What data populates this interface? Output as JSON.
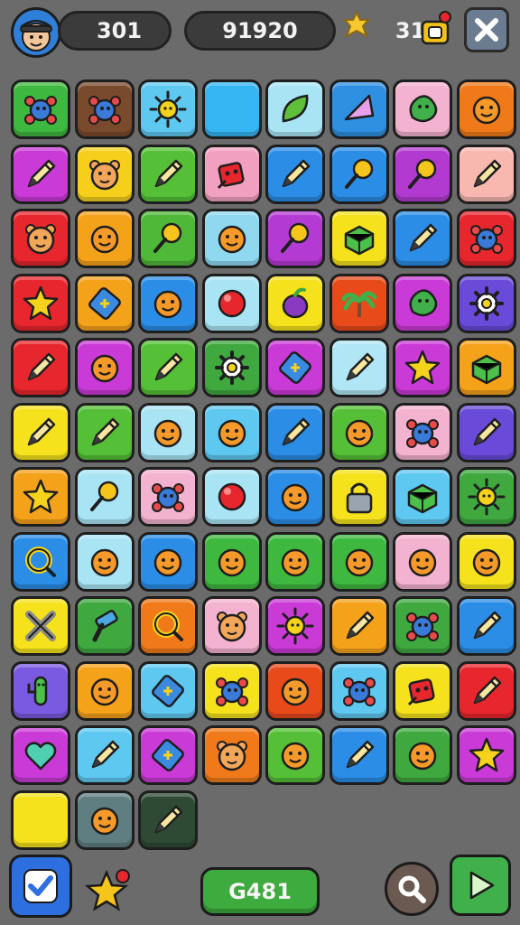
{
  "header": {
    "level": "301",
    "score": "91920",
    "coins": "310"
  },
  "footer": {
    "moves": "G481"
  },
  "icon_names": {
    "avatar": "player-avatar",
    "coin": "coin-icon",
    "gift": "gift-icon",
    "close": "close-icon",
    "check": "check-icon",
    "star": "star-icon",
    "search": "magnifier-icon",
    "play": "play-icon"
  },
  "colors": {
    "board_background": "#6b6b6b",
    "tile_outline": "#1e1e1e"
  },
  "board": {
    "rows": [
      [
        {
          "c": "#3fb83f",
          "i": "bug"
        },
        {
          "c": "#7a4a2c",
          "i": "bug"
        },
        {
          "c": "#5ec8f0",
          "i": "sun"
        },
        {
          "c": "#35b5f2",
          "i": "blank"
        },
        {
          "c": "#a9e4f5",
          "i": "leaf"
        },
        {
          "c": "#2f8fe0",
          "i": "gem"
        },
        {
          "c": "#f3b2cf",
          "i": "blob"
        },
        {
          "c": "#f07a1a",
          "i": "face"
        }
      ],
      [
        {
          "c": "#c93ad6",
          "i": "pencil"
        },
        {
          "c": "#f5cf1c",
          "i": "bear"
        },
        {
          "c": "#55c037",
          "i": "pencil"
        },
        {
          "c": "#f2a0c0",
          "i": "robot"
        },
        {
          "c": "#2b8de6",
          "i": "pencil"
        },
        {
          "c": "#2b8de6",
          "i": "lolly"
        },
        {
          "c": "#b23ad0",
          "i": "lolly"
        },
        {
          "c": "#f8b8b0",
          "i": "pencil"
        }
      ],
      [
        {
          "c": "#e8262e",
          "i": "bear"
        },
        {
          "c": "#f4a21a",
          "i": "face"
        },
        {
          "c": "#50b838",
          "i": "lolly"
        },
        {
          "c": "#8fd8f0",
          "i": "face"
        },
        {
          "c": "#b43ad4",
          "i": "lolly"
        },
        {
          "c": "#f5e21c",
          "i": "box"
        },
        {
          "c": "#2b8de6",
          "i": "pencil"
        },
        {
          "c": "#e8262e",
          "i": "bug"
        }
      ],
      [
        {
          "c": "#e8262e",
          "i": "star"
        },
        {
          "c": "#f4a21a",
          "i": "card"
        },
        {
          "c": "#2b8de6",
          "i": "face"
        },
        {
          "c": "#a9e4f5",
          "i": "ball"
        },
        {
          "c": "#f5e21c",
          "i": "fruit"
        },
        {
          "c": "#e84a1a",
          "i": "palm"
        },
        {
          "c": "#c93ad6",
          "i": "blob"
        },
        {
          "c": "#6a4ad8",
          "i": "gear"
        }
      ],
      [
        {
          "c": "#e8262e",
          "i": "pencil"
        },
        {
          "c": "#c93ad6",
          "i": "face"
        },
        {
          "c": "#55c037",
          "i": "pencil"
        },
        {
          "c": "#3fa83f",
          "i": "gear"
        },
        {
          "c": "#c93ad6",
          "i": "card"
        },
        {
          "c": "#b0e6f5",
          "i": "pencil"
        },
        {
          "c": "#c93ad6",
          "i": "star"
        },
        {
          "c": "#f4a21a",
          "i": "box"
        }
      ],
      [
        {
          "c": "#f5e21c",
          "i": "pencil"
        },
        {
          "c": "#55c037",
          "i": "pencil"
        },
        {
          "c": "#a9e4f5",
          "i": "face"
        },
        {
          "c": "#5ec8f0",
          "i": "face"
        },
        {
          "c": "#2b8de6",
          "i": "pencil"
        },
        {
          "c": "#55c037",
          "i": "face"
        },
        {
          "c": "#f3b2cf",
          "i": "bug"
        },
        {
          "c": "#6a4ad8",
          "i": "pencil"
        }
      ],
      [
        {
          "c": "#f4a21a",
          "i": "star"
        },
        {
          "c": "#a9e4f5",
          "i": "lolly"
        },
        {
          "c": "#f3b2cf",
          "i": "bug"
        },
        {
          "c": "#a9e4f5",
          "i": "ball"
        },
        {
          "c": "#2b8de6",
          "i": "face"
        },
        {
          "c": "#f5e21c",
          "i": "lock"
        },
        {
          "c": "#5ec8f0",
          "i": "box"
        },
        {
          "c": "#3fa83f",
          "i": "sun"
        }
      ],
      [
        {
          "c": "#2b8de6",
          "i": "ring"
        },
        {
          "c": "#a9e4f5",
          "i": "face"
        },
        {
          "c": "#2b8de6",
          "i": "face"
        },
        {
          "c": "#3fb83f",
          "i": "face"
        },
        {
          "c": "#3fb83f",
          "i": "face"
        },
        {
          "c": "#3fb83f",
          "i": "face"
        },
        {
          "c": "#f3b2cf",
          "i": "face"
        },
        {
          "c": "#f5e21c",
          "i": "face"
        }
      ],
      [
        {
          "c": "#f5e21c",
          "i": "cross"
        },
        {
          "c": "#3fa83f",
          "i": "hammer"
        },
        {
          "c": "#f07a1a",
          "i": "ring"
        },
        {
          "c": "#f3b2cf",
          "i": "bear"
        },
        {
          "c": "#c93ad6",
          "i": "sun"
        },
        {
          "c": "#f4a21a",
          "i": "pencil"
        },
        {
          "c": "#3fa83f",
          "i": "bug"
        },
        {
          "c": "#2b8de6",
          "i": "pencil"
        }
      ],
      [
        {
          "c": "#7a5ae0",
          "i": "cactus"
        },
        {
          "c": "#f4a21a",
          "i": "face"
        },
        {
          "c": "#5ec8f0",
          "i": "card"
        },
        {
          "c": "#f5e21c",
          "i": "bug"
        },
        {
          "c": "#e84a1a",
          "i": "face"
        },
        {
          "c": "#5ec8f0",
          "i": "bug"
        },
        {
          "c": "#f5e21c",
          "i": "robot"
        },
        {
          "c": "#e8262e",
          "i": "pencil"
        }
      ],
      [
        {
          "c": "#c93ad6",
          "i": "heart"
        },
        {
          "c": "#5ec8f0",
          "i": "pencil"
        },
        {
          "c": "#c93ad6",
          "i": "card"
        },
        {
          "c": "#f07a1a",
          "i": "bear"
        },
        {
          "c": "#55c037",
          "i": "face"
        },
        {
          "c": "#2b8de6",
          "i": "pencil"
        },
        {
          "c": "#3fa83f",
          "i": "face"
        },
        {
          "c": "#c93ad6",
          "i": "star"
        }
      ],
      [
        {
          "c": "#f5e21c",
          "i": "blank"
        },
        {
          "c": "#5e7e82",
          "i": "face"
        },
        {
          "c": "#2f4a34",
          "i": "pencil"
        }
      ]
    ]
  }
}
